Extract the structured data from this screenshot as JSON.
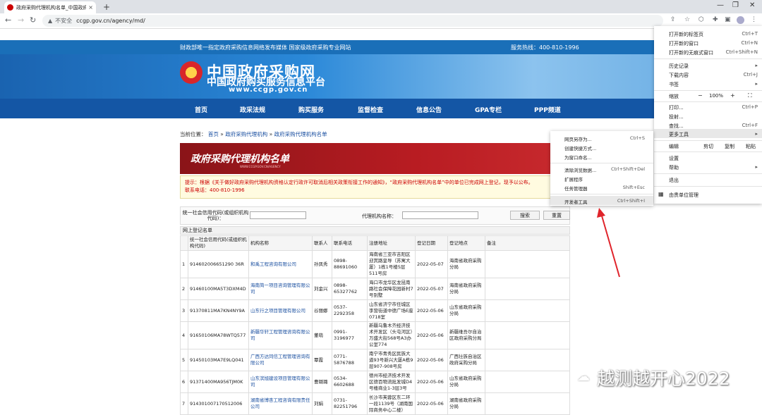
{
  "browser": {
    "tab_title": "政府采购代理机构名单_中国政府",
    "url": "ccgp.gov.cn/agency/md/",
    "insecure_label": "不安全",
    "new_tab": "+",
    "tab_close": "×"
  },
  "site": {
    "top_left": "财政部唯一指定政府采购信息网络发布媒体 国家级政府采购专业网站",
    "hotline": "服务热线：400-810-1996",
    "title_cn": "中国政府采购网",
    "title_sub": "中国政府购买服务信息平台",
    "domain": "www.ccgp.gov.cn",
    "nav": [
      "首页",
      "政采法规",
      "购买服务",
      "监督检查",
      "信息公告",
      "GPA专栏",
      "PPP频道"
    ]
  },
  "breadcrumb": {
    "prefix": "当前位置：",
    "items": [
      "首页",
      "政府采购代理机构",
      "政府采购代理机构名单"
    ]
  },
  "list_banner": {
    "title": "政府采购代理机构名单",
    "subtitle": "WWW.CCGP.GOV.CN/AGENCY"
  },
  "notice": {
    "text": "提示：根据《关于做好政府采购代理机构资格认定行政许可取消后相关政策衔接工作的通知》，“政府采购代理机构名单”中的单位已完成网上登记，现予以公布。",
    "phone": "联系电话：400-810-1996"
  },
  "search": {
    "credit_label": "统一社会信用代码(或组织机构代码)：",
    "name_label": "代理机构名称：",
    "search_btn": "搜索",
    "reset_btn": "重置"
  },
  "table": {
    "section_title": "网上登记名单",
    "headers": [
      "",
      "统一社会信用代码(或组织机构代码)",
      "机构名称",
      "联系人",
      "联系电话",
      "注册地址",
      "登记日期",
      "登记地点",
      "备注"
    ],
    "rows": [
      [
        "1",
        "914602006651290 36R",
        "和禹工程咨询有限公司",
        "孙凤秀",
        "0898-88691060",
        "海南省三亚市吉阳区迎宾路皇导（苏寓大厦）1栋1号楼5层511号房",
        "2022-05-07",
        "海南省政府采购分局",
        ""
      ],
      [
        "2",
        "91460100MA5T3DXM4D",
        "海南简一项目咨询管理有限公司",
        "刘金兴",
        "0898-65327762",
        "海口市龙华区龙昆南路社会保障花园新村7号别墅",
        "2022-05-07",
        "海南省政府采购分局",
        ""
      ],
      [
        "3",
        "91370811MA7KN4NY9A",
        "山东行之项目管理有限公司",
        "谷丽娜",
        "0537-2292358",
        "山东省济宁市任城区李营街道中德广场E座0718室",
        "2022-05-06",
        "山东省政府采购分局",
        ""
      ],
      [
        "4",
        "91650106MA78WTQ577",
        "新疆华轩工程管理咨询有限公司",
        "董萌",
        "0991-3196977",
        "新疆乌鲁木齐经济技术开发区（头屯河区）万盛大街568号A3办公室774",
        "2022-05-06",
        "新疆维吾尔自治区政府采购分局",
        ""
      ],
      [
        "5",
        "91450103MA7E9LQ041",
        "广西方达同信工程管理咨询有限公司",
        "覃霞",
        "0771-5876788",
        "南宁市青秀区民族大道93号新兴大厦A栋9层907-908号房",
        "2022-05-06",
        "广西壮族自治区政府采购分局",
        ""
      ],
      [
        "6",
        "91371400MA956TJM0K",
        "山东滨旭建设项目管理有限公司",
        "曹璐璐",
        "0534-6602688",
        "德州市经济技术开发区德百物流批发城D4号楼商业1-3层3号",
        "2022-05-06",
        "山东省政府采购分局",
        ""
      ],
      [
        "7",
        "914301007170512006",
        "湖南省博杏工程咨询有限责任公司",
        "刘娟",
        "0731-82251796",
        "长沙市芙蓉区东二环一段1139号（湖南国际商务中心二楼）",
        "2022-05-06",
        "湖南省政府采购分局",
        ""
      ]
    ]
  },
  "chrome_menu": {
    "items": [
      {
        "label": "打开新的标签页",
        "shortcut": "Ctrl+T"
      },
      {
        "label": "打开新的窗口",
        "shortcut": "Ctrl+N"
      },
      {
        "label": "打开新的无痕式窗口",
        "shortcut": "Ctrl+Shift+N"
      },
      {
        "label": "历史记录",
        "shortcut": "▸"
      },
      {
        "label": "下载内容",
        "shortcut": "Ctrl+J"
      },
      {
        "label": "书签",
        "shortcut": "▸"
      },
      {
        "label": "缩放",
        "shortcut": ""
      },
      {
        "label": "打印...",
        "shortcut": "Ctrl+P"
      },
      {
        "label": "投射...",
        "shortcut": ""
      },
      {
        "label": "查找...",
        "shortcut": "Ctrl+F"
      },
      {
        "label": "更多工具",
        "shortcut": "▸"
      },
      {
        "label": "编辑",
        "shortcut": ""
      },
      {
        "label": "设置",
        "shortcut": ""
      },
      {
        "label": "帮助",
        "shortcut": "▸"
      },
      {
        "label": "退出",
        "shortcut": ""
      },
      {
        "label": "由贵单位管理",
        "shortcut": ""
      }
    ],
    "zoom": {
      "minus": "−",
      "value": "100%",
      "plus": "+",
      "full": "⛶"
    },
    "edit": {
      "cut": "剪切",
      "copy": "复制",
      "paste": "粘贴"
    }
  },
  "submenu": {
    "items": [
      {
        "label": "网页另存为...",
        "shortcut": "Ctrl+S"
      },
      {
        "label": "创建快捷方式...",
        "shortcut": ""
      },
      {
        "label": "为窗口命名...",
        "shortcut": ""
      },
      {
        "label": "清除浏览数据...",
        "shortcut": "Ctrl+Shift+Del"
      },
      {
        "label": "扩展程序",
        "shortcut": ""
      },
      {
        "label": "任务管理器",
        "shortcut": "Shift+Esc"
      },
      {
        "label": "开发者工具",
        "shortcut": "Ctrl+Shift+I"
      }
    ]
  },
  "watermark": "越测越开心2022",
  "colors": {
    "nav_blue": "#1456a5",
    "banner_red": "#b81c22",
    "link": "#1a4fa0"
  }
}
